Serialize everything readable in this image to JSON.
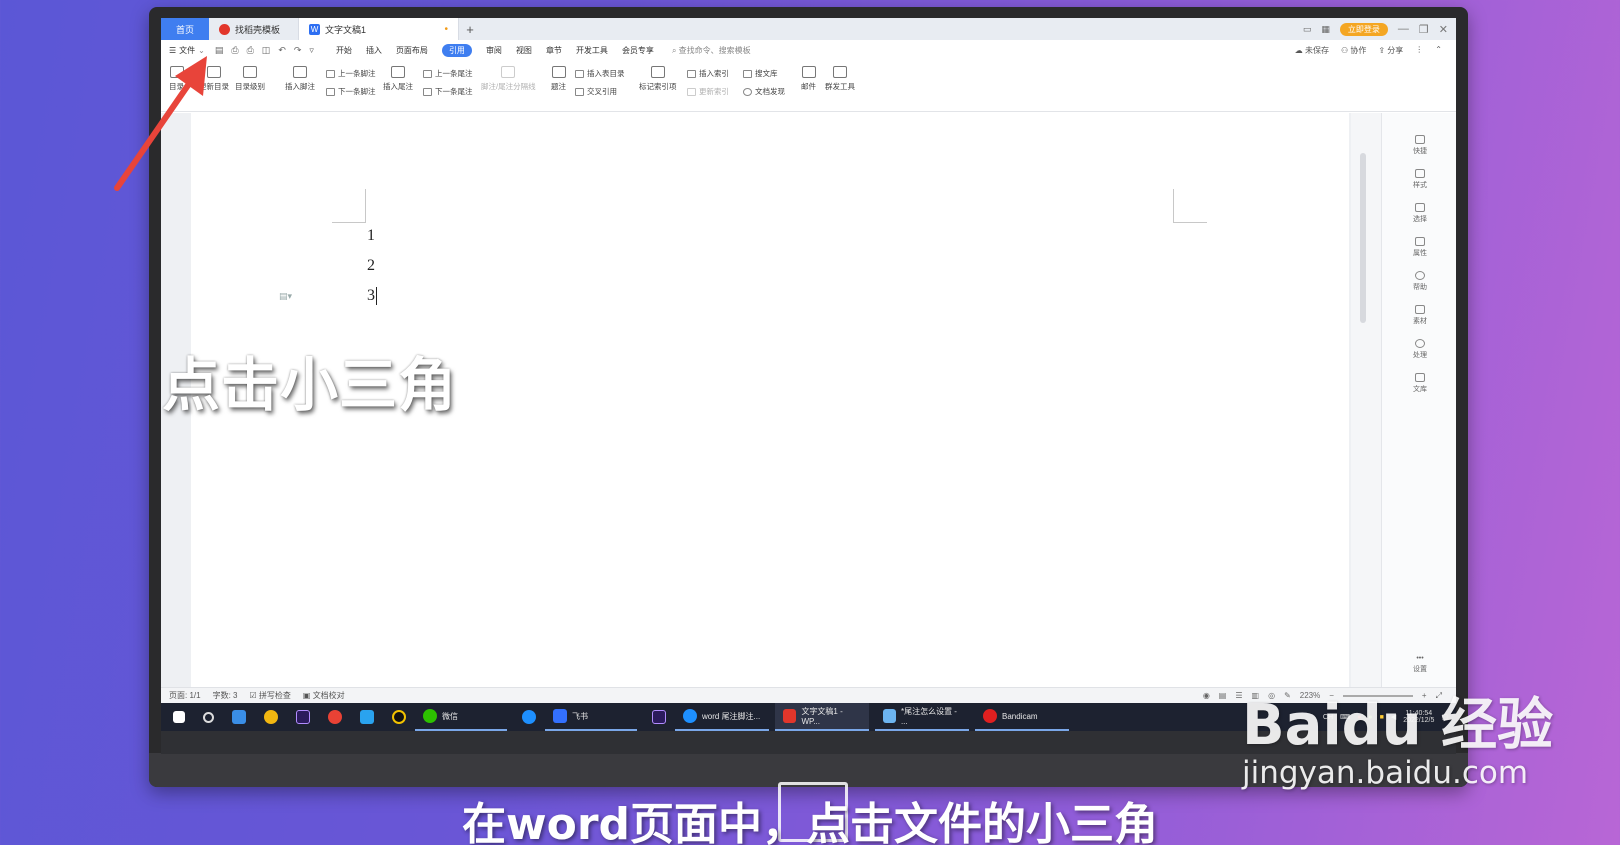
{
  "tabbar": {
    "home_label": "首页",
    "tab1_label": "找稻壳模板",
    "tab2_label": "文字文稿1",
    "unsaved_dot": "•",
    "add_tab": "+",
    "login_label": "立即登录",
    "minimize": "—",
    "restore": "❐",
    "close": "✕"
  },
  "menubar": {
    "file_label": "文件",
    "items": [
      "开始",
      "插入",
      "页面布局",
      "引用",
      "审阅",
      "视图",
      "章节",
      "开发工具",
      "会员专享"
    ],
    "search_placeholder": "查找命令、搜索模板",
    "unsaved_label": "未保存",
    "collab_label": "协作",
    "share_label": "分享"
  },
  "ribbon": {
    "toc": "目录",
    "update_toc": "更新目录",
    "toc_level": "目录级别",
    "insert_footnote": "插入脚注",
    "prev_footnote": "上一条脚注",
    "next_footnote": "下一条脚注",
    "insert_endnote": "插入尾注",
    "prev_endnote": "上一条尾注",
    "next_endnote": "下一条尾注",
    "note_separator": "脚注/尾注分隔线",
    "caption": "题注",
    "insert_table_of_figures": "插入表目录",
    "cross_reference": "交叉引用",
    "mark_citation": "标记索引项",
    "insert_index": "插入索引",
    "update_index": "更新索引",
    "search_library": "搜文库",
    "doc_check": "文档发现",
    "mail": "邮件",
    "mass_tools": "群发工具"
  },
  "document": {
    "lines": [
      "1",
      "2",
      "3"
    ]
  },
  "side_panel": {
    "items": [
      "快捷",
      "样式",
      "选择",
      "属性",
      "帮助",
      "素材",
      "处理",
      "文库"
    ],
    "settings": "设置"
  },
  "statusbar": {
    "page": "页面: 1/1",
    "word_count": "字数: 3",
    "spell_check": "拼写检查",
    "proofread": "文档校对",
    "zoom": "223%"
  },
  "taskbar": {
    "wechat": "微信",
    "feishu": "飞书",
    "app_word_notes": "word 尾注脚注...",
    "app_wps": "文字文稿1 - WP...",
    "app_notes": "*尾注怎么设置 - ...",
    "app_bandicam": "Bandicam",
    "ime": "CH",
    "time": "11:40:54",
    "date": "2022/12/5"
  },
  "overlay": {
    "title": "点击小三角",
    "subtitle": "在word页面中，点击文件的小三角"
  },
  "watermark": {
    "logo": "Baidu 经验",
    "url": "jingyan.baidu.com"
  },
  "colors": {
    "accent": "#3f7ef0",
    "arrow": "#e8443a",
    "login": "#f4a623"
  }
}
